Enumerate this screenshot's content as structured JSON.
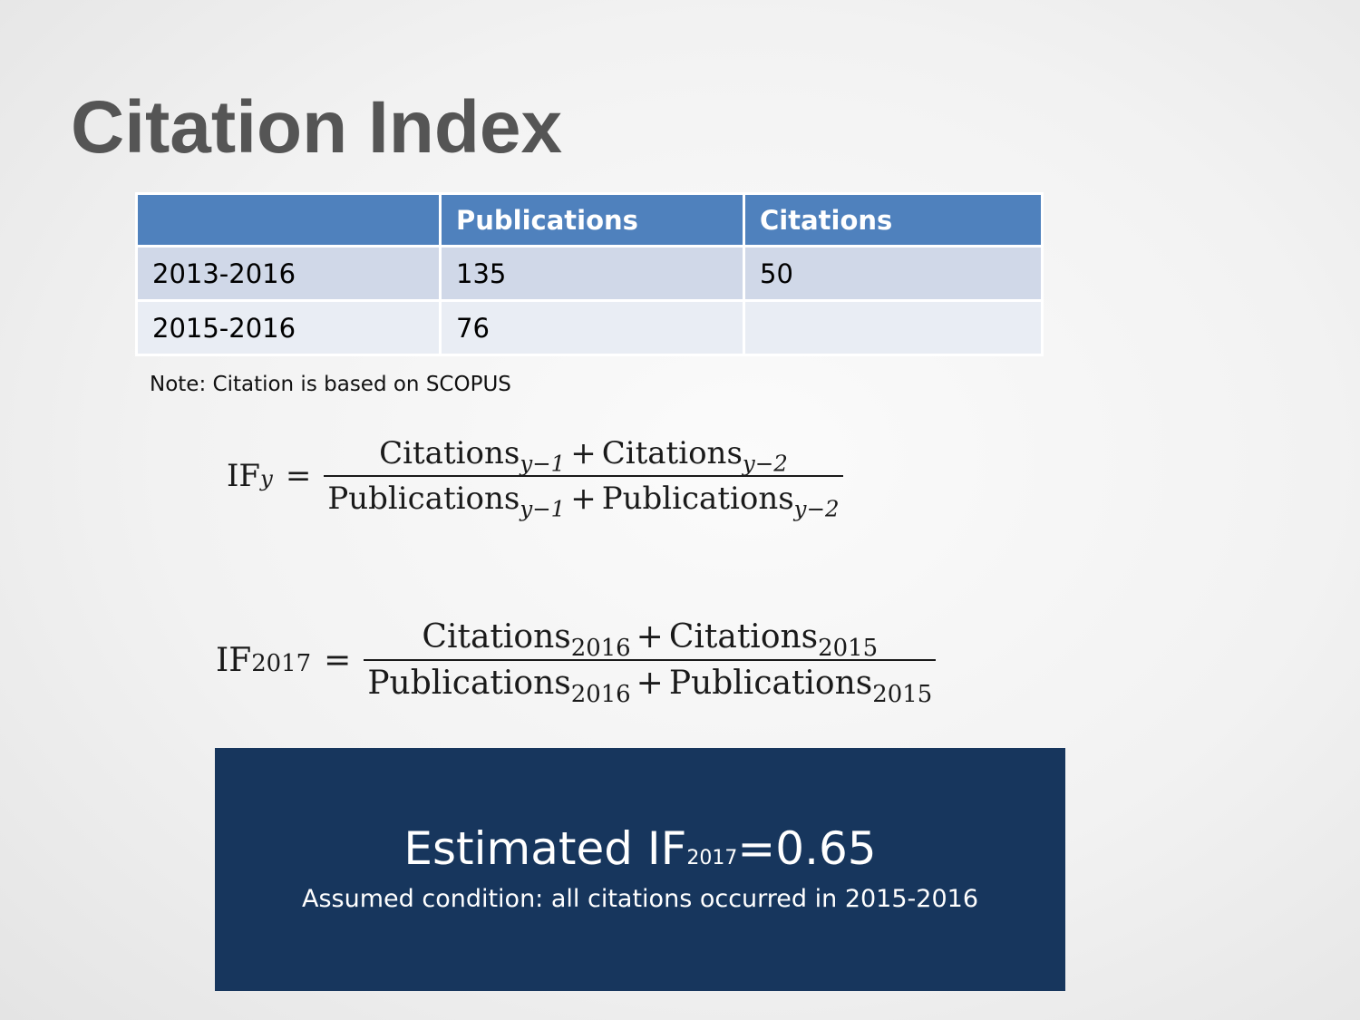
{
  "slide": {
    "title": "Citation Index",
    "table": {
      "headers": [
        "",
        "Publications",
        "Citations"
      ],
      "rows": [
        [
          "2013-2016",
          "135",
          "50"
        ],
        [
          "2015-2016",
          "76",
          ""
        ]
      ]
    },
    "note": "Note: Citation is based on SCOPUS",
    "formula_general": {
      "lhs": "IF",
      "lhs_sub": "y",
      "eq": "=",
      "num_a": "Citations",
      "num_a_sub": "y−1",
      "num_b": "Citations",
      "num_b_sub": "y−2",
      "den_a": "Publications",
      "den_a_sub": "y−1",
      "den_b": "Publications",
      "den_b_sub": "y−2",
      "plus": "+"
    },
    "formula_2017": {
      "lhs": "IF",
      "lhs_sub": "2017",
      "eq": "=",
      "num_a": "Citations",
      "num_a_sub": "2016",
      "num_b": "Citations",
      "num_b_sub": "2015",
      "den_a": "Publications",
      "den_a_sub": "2016",
      "den_b": "Publications",
      "den_b_sub": "2015",
      "plus": "+"
    },
    "result": {
      "label": "Estimated IF",
      "label_sub": "2017",
      "value": "=0.65",
      "condition": "Assumed condition: all citations occurred in 2015-2016"
    },
    "colors": {
      "header_blue": "#4f81bd",
      "row_odd": "#d0d8e8",
      "row_even": "#e9edf4",
      "result_navy": "#17365d",
      "title_gray": "#555555"
    }
  }
}
